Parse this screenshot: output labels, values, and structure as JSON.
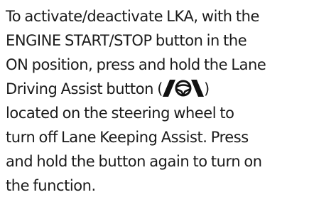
{
  "paragraph": {
    "lines": [
      "To activate/deactivate LKA, with the",
      "ENGINE START/STOP button in the",
      "ON position, press and hold the Lane",
      "located on the steering wheel to",
      "turn off Lane Keeping Assist. Press",
      "and hold the button again to turn on",
      "the function."
    ],
    "icon_line": {
      "before": "Driving Assist button (",
      "after": ")"
    },
    "icon": "lane-driving-assist-icon"
  }
}
